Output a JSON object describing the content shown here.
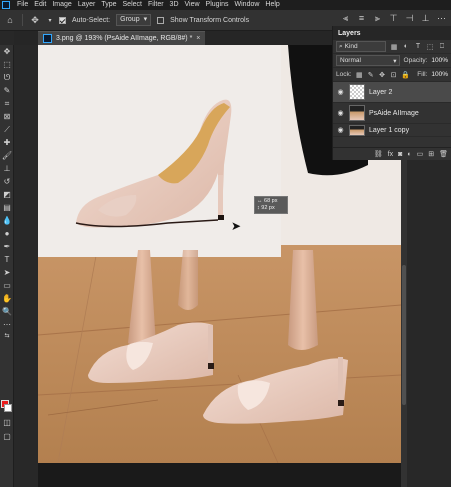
{
  "menubar": {
    "items": [
      "File",
      "Edit",
      "Image",
      "Layer",
      "Type",
      "Select",
      "Filter",
      "3D",
      "View",
      "Plugins",
      "Window",
      "Help"
    ]
  },
  "options": {
    "auto_select_label": "Auto-Select:",
    "auto_select_value": "Group",
    "transform_label": "Show Transform Controls"
  },
  "document": {
    "tab_title": "3.png @ 193% (PsAide AIImage, RGB/8#) *",
    "close_glyph": "×"
  },
  "measure": {
    "width": "68 px",
    "height": "92 px"
  },
  "layers_panel": {
    "title": "Layers",
    "kind_label": "Kind",
    "blend_mode": "Normal",
    "opacity_label": "Opacity:",
    "opacity_value": "100%",
    "lock_label": "Lock:",
    "fill_label": "Fill:",
    "fill_value": "100%",
    "layers": [
      {
        "name": "Layer 2",
        "selected": true
      },
      {
        "name": "PsAide AIImage",
        "selected": false
      },
      {
        "name": "Layer 1 copy",
        "selected": false
      }
    ],
    "footer_icons": [
      "link-icon",
      "fx-icon",
      "mask-icon",
      "adjustment-icon",
      "folder-icon",
      "new-layer-icon",
      "trash-icon"
    ]
  },
  "colors": {
    "foreground": "#e81c1c",
    "background": "#ffffff",
    "accent": "#31a8ff"
  }
}
